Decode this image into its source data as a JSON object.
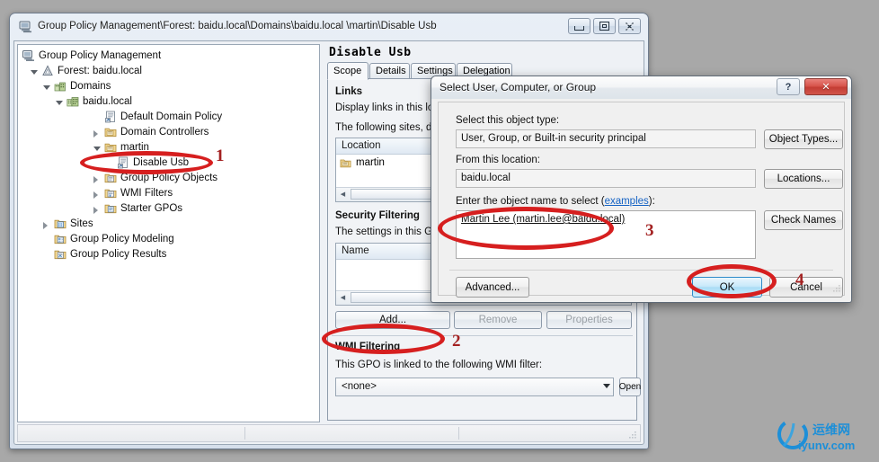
{
  "window": {
    "title": "Group Policy Management\\Forest: baidu.local\\Domains\\baidu.local \\martin\\Disable Usb",
    "title_icon": "console-icon",
    "controls": {
      "minimize": "minimize-icon",
      "maximize": "maximize-icon",
      "close": "close-icon"
    }
  },
  "tree": {
    "items": [
      {
        "label": "Group Policy Management",
        "indent": 0,
        "twist": "none",
        "icon": "console-icon"
      },
      {
        "label": "Forest: baidu.local",
        "indent": 1,
        "twist": "open",
        "icon": "forest-icon"
      },
      {
        "label": "Domains",
        "indent": 2,
        "twist": "open",
        "icon": "domains-icon"
      },
      {
        "label": "baidu.local",
        "indent": 3,
        "twist": "open",
        "icon": "domain-icon"
      },
      {
        "label": "Default Domain Policy",
        "indent": 5,
        "twist": "none",
        "icon": "gpo-icon"
      },
      {
        "label": "Domain Controllers",
        "indent": 4,
        "twist": "closed",
        "icon": "ou-icon"
      },
      {
        "label": "martin",
        "indent": 4,
        "twist": "open",
        "icon": "ou-icon"
      },
      {
        "label": "Disable Usb",
        "indent": 5,
        "twist": "none",
        "icon": "gpo-icon"
      },
      {
        "label": "Group Policy Objects",
        "indent": 4,
        "twist": "closed",
        "icon": "gpo-folder-icon"
      },
      {
        "label": "WMI Filters",
        "indent": 4,
        "twist": "closed",
        "icon": "wmi-folder-icon"
      },
      {
        "label": "Starter GPOs",
        "indent": 4,
        "twist": "closed",
        "icon": "starter-folder-icon"
      },
      {
        "label": "Sites",
        "indent": 2,
        "twist": "closed",
        "icon": "sites-icon"
      },
      {
        "label": "Group Policy Modeling",
        "indent": 2,
        "twist": "none",
        "icon": "modeling-icon"
      },
      {
        "label": "Group Policy Results",
        "indent": 2,
        "twist": "none",
        "icon": "results-icon"
      }
    ]
  },
  "detail": {
    "gpo_name": "Disable Usb",
    "tabs": [
      {
        "label": "Scope",
        "selected": true
      },
      {
        "label": "Details",
        "selected": false
      },
      {
        "label": "Settings",
        "selected": false
      },
      {
        "label": "Delegation",
        "selected": false
      }
    ],
    "links": {
      "heading": "Links",
      "line1": "Display links in this location:",
      "line2": "The following sites, domains, and OUs are linked to this GPO:",
      "column_header": "Location",
      "rows": [
        {
          "location": "martin",
          "icon": "ou-icon"
        }
      ]
    },
    "security_filtering": {
      "heading": "Security Filtering",
      "description": "The settings in this GPO can only apply to the following groups, users, and computers:",
      "column_header": "Name",
      "rows": [],
      "buttons": [
        {
          "label": "Add...",
          "enabled": true
        },
        {
          "label": "Remove",
          "enabled": false
        },
        {
          "label": "Properties",
          "enabled": false
        }
      ]
    },
    "wmi_filtering": {
      "heading": "WMI Filtering",
      "description": "This GPO is linked to the following WMI filter:",
      "selected_filter": "<none>",
      "options": [
        "<none>"
      ],
      "open_button": "Open"
    }
  },
  "dialog": {
    "title": "Select User, Computer, or Group",
    "help_glyph": "?",
    "close_glyph": "✕",
    "object_type_label": "Select this object type:",
    "object_type_value": "User, Group, or Built-in security principal",
    "object_types_button": "Object Types...",
    "location_label": "From this location:",
    "location_value": "baidu.local",
    "locations_button": "Locations...",
    "object_name_label_pre": "Enter the object name to select (",
    "object_name_label_link": "examples",
    "object_name_label_post": "):",
    "object_name_value": "Martin Lee (martin.lee@baidu.local)",
    "check_names_button": "Check Names",
    "advanced_button": "Advanced...",
    "ok_button": "OK",
    "cancel_button": "Cancel"
  },
  "annotations": {
    "markers": [
      {
        "number": "1",
        "target": "tree-item-disable-usb"
      },
      {
        "number": "2",
        "target": "remove-button"
      },
      {
        "number": "3",
        "target": "object-name-textarea"
      },
      {
        "number": "4",
        "target": "ok-button"
      }
    ],
    "color": "#d61f1f",
    "number_color": "#a32121"
  },
  "watermark": {
    "cn_text": "运维网",
    "domain_text": "iyunv.com",
    "color": "#1d8fd8"
  }
}
